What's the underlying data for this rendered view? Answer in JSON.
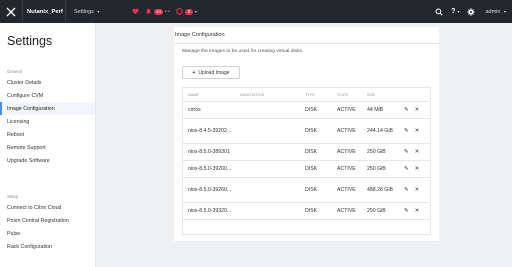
{
  "topbar": {
    "cluster_name": "Nutanix_Perf",
    "page_selector": "Settings",
    "alerts_count": "14",
    "events_count": "2",
    "help_label": "?",
    "user": "admin"
  },
  "sidebar": {
    "title": "Settings",
    "general_label": "General",
    "general_items": [
      {
        "label": "Cluster Details"
      },
      {
        "label": "Configure CVM"
      },
      {
        "label": "Image Configuration"
      },
      {
        "label": "Licensing"
      },
      {
        "label": "Reboot"
      },
      {
        "label": "Remote Support"
      },
      {
        "label": "Upgrade Software"
      }
    ],
    "setup_label": "Setup",
    "setup_items": [
      {
        "label": "Connect to Citrix Cloud"
      },
      {
        "label": "Prism Central Registration"
      },
      {
        "label": "Pulse"
      },
      {
        "label": "Rack Configuration"
      }
    ]
  },
  "main": {
    "title": "Image Configuration",
    "description": "Manage the images to be used for creating virtual disks.",
    "upload_label": "Upload Image",
    "columns": [
      "NAME",
      "ANNOTATION",
      "TYPE",
      "STATE",
      "SIZE"
    ],
    "rows": [
      {
        "name": "cirros",
        "annotation": "",
        "type": "DISK",
        "state": "ACTIVE",
        "size": "44 MiB"
      },
      {
        "name": "nios-8.4.5-39202...",
        "annotation": "",
        "type": "DISK",
        "state": "ACTIVE",
        "size": "244.14 GiB"
      },
      {
        "name": "nios-8.5.0-389301",
        "annotation": "",
        "type": "DISK",
        "state": "ACTIVE",
        "size": "250 GiB"
      },
      {
        "name": "nios-8.5.0-39260...",
        "annotation": "",
        "type": "DISK",
        "state": "ACTIVE",
        "size": "250 GiB"
      },
      {
        "name": "nios-8.5.0-39260...",
        "annotation": "",
        "type": "DISK",
        "state": "ACTIVE",
        "size": "488.28 GiB"
      },
      {
        "name": "nios-8.5.0-39320...",
        "annotation": "",
        "type": "DISK",
        "state": "ACTIVE",
        "size": "250 GiB"
      }
    ],
    "edit_icon": "pencil-icon",
    "delete_icon": "close-icon"
  }
}
